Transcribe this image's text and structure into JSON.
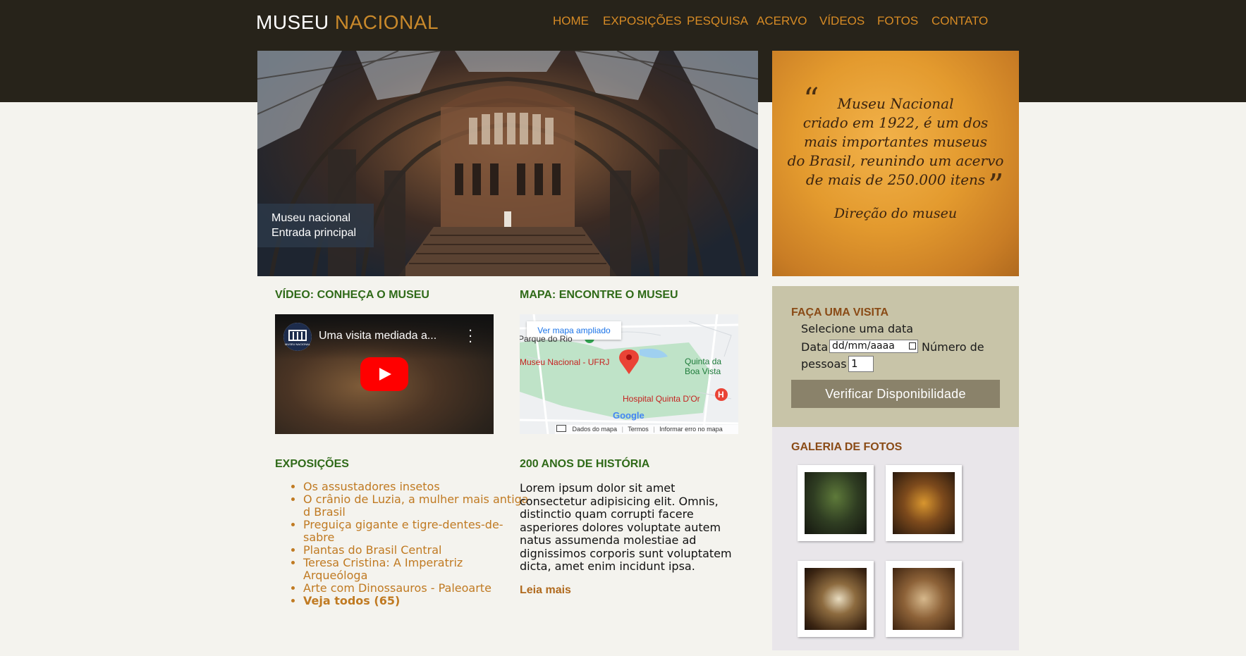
{
  "header": {
    "logo_part1": "MUSEU",
    "logo_part2": "NACIONAL",
    "nav": [
      "HOME",
      "EXPOSIÇÕES",
      "PESQUISA",
      "ACERVO",
      "VÍDEOS",
      "FOTOS",
      "CONTATO"
    ]
  },
  "hero": {
    "caption_line1": "Museu nacional",
    "caption_line2": "Entrada principal"
  },
  "quote": {
    "open_mark": "“",
    "close_mark": "”",
    "text_lines": [
      "Museu Nacional",
      "criado em 1922, é um dos",
      "mais importantes museus",
      "do Brasil, reunindo um acervo",
      "de mais de 250.000 itens"
    ],
    "author": "Direção do museu"
  },
  "video_section": {
    "title": "VÍDEO: CONHEÇA O MUSEU",
    "video_title": "Uma visita mediada a...",
    "channel_label": "MUSEU NACIONAL"
  },
  "map_section": {
    "title": "MAPA: ENCONTRE O MUSEU",
    "button": "Ver mapa ampliado",
    "labels": {
      "park": "Parque do Rio",
      "museum": "Museu Nacional - UFRJ",
      "quinta_line1": "Quinta da",
      "quinta_line2": "Boa Vista",
      "hospital": "Hospital Quinta D'Or",
      "hospital_marker": "H"
    },
    "brand": "Google",
    "footer": [
      "Dados do mapa",
      "Termos",
      "Informar erro no mapa"
    ]
  },
  "exposicoes": {
    "title": "EXPOSIÇÕES",
    "items": [
      "Os assustadores insetos",
      "O crânio de Luzia, a mulher mais antiga d Brasil",
      "Preguiça gigante e tigre-dentes-de-sabre",
      "Plantas do Brasil Central",
      "Teresa Cristina: A Imperatriz Arqueóloga",
      "Arte com Dinossauros - Paleoarte"
    ],
    "see_all": "Veja todos (65)"
  },
  "historia": {
    "title": "200 ANOS DE HISTÓRIA",
    "text": "Lorem ipsum dolor sit amet consectetur adipisicing elit. Omnis, distinctio quam corrupti facere asperiores dolores voluptate autem natus assumenda molestiae ad dignissimos corporis sunt voluptatem dicta, amet enim incidunt ipsa.",
    "read_more": "Leia mais"
  },
  "visita": {
    "title": "FAÇA UMA VISITA",
    "subtitle": "Selecione uma data",
    "date_label": "Data",
    "date_placeholder": "dd/mm/aaaa",
    "people_label_1": "Número de",
    "people_label_2": "pessoas",
    "people_value": "1",
    "button": "Verificar Disponibilidade"
  },
  "galeria": {
    "title": "GALERIA DE FOTOS"
  },
  "colors": {
    "header_bg": "#27231a",
    "nav_text": "#d78b25",
    "section_title": "#2f6a18",
    "link": "#c07a22",
    "accent_brown": "#8a4b16",
    "quote_bg": "#e39a2e",
    "visit_bg": "#c8c4a8",
    "gallery_bg": "#e9e6ea",
    "page_bg": "#f4f3ee"
  }
}
